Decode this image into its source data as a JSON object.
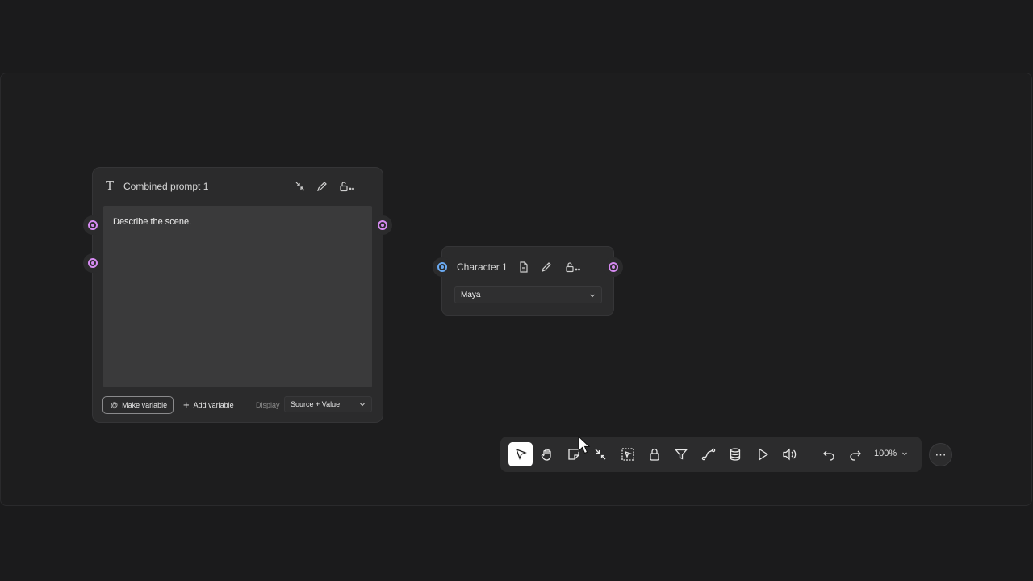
{
  "prompt_node": {
    "title": "Combined prompt 1",
    "icon": "text-T-icon",
    "prompt_text": "Describe the scene.",
    "make_variable_label": "Make variable",
    "make_variable_symbol": "@",
    "add_variable_label": "Add variable",
    "display_label": "Display",
    "display_value": "Source + Value"
  },
  "character_node": {
    "title": "Character 1",
    "selected_value": "Maya"
  },
  "toolbar": {
    "tools": [
      "select-tool",
      "hand-tool",
      "sticky-note-tool",
      "collapse-tool",
      "frame-select-tool",
      "lock-tool",
      "filter-tool",
      "connector-tool",
      "database-tool",
      "play-tool",
      "volume-tool",
      "undo",
      "redo"
    ],
    "zoom": "100%",
    "more": "⋯"
  },
  "colors": {
    "port_output": "#d58af0",
    "port_input": "#6aa9f0",
    "node_bg": "#2b2b2c",
    "canvas_bg": "#1d1d1e"
  }
}
